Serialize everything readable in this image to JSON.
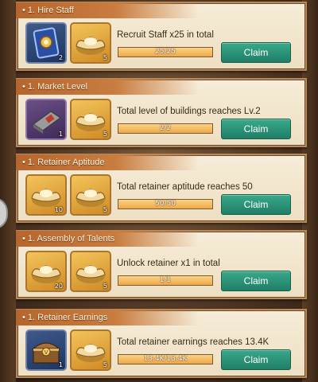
{
  "tasks": [
    {
      "title": "• 1. Hire Staff",
      "description": "Recruit Staff x25 in total",
      "progress_text": "25/25",
      "progress_fraction": 1.0,
      "claim_label": "Claim",
      "rewards": [
        {
          "icon": "recruit-card-icon",
          "qty": "2"
        },
        {
          "icon": "gold-ingot-icon",
          "qty": "5"
        }
      ]
    },
    {
      "title": "• 1. Market Level",
      "description": "Total level of buildings reaches Lv.2",
      "progress_text": "2/2",
      "progress_fraction": 1.0,
      "claim_label": "Claim",
      "rewards": [
        {
          "icon": "book-icon",
          "qty": "1"
        },
        {
          "icon": "gold-ingot-icon",
          "qty": "5"
        }
      ]
    },
    {
      "title": "• 1. Retainer Aptitude",
      "description": "Total retainer aptitude reaches 50",
      "progress_text": "50/50",
      "progress_fraction": 1.0,
      "claim_label": "Claim",
      "rewards": [
        {
          "icon": "gold-ingot-icon",
          "qty": "10"
        },
        {
          "icon": "gold-ingot-icon",
          "qty": "5"
        }
      ]
    },
    {
      "title": "• 1. Assembly of Talents",
      "description": "Unlock  retainer x1 in total",
      "progress_text": "1/1",
      "progress_fraction": 1.0,
      "claim_label": "Claim",
      "rewards": [
        {
          "icon": "gold-ingot-icon",
          "qty": "20"
        },
        {
          "icon": "gold-ingot-icon",
          "qty": "5"
        }
      ]
    },
    {
      "title": "• 1. Retainer Earnings",
      "description": "Total retainer earnings reaches 13.4K",
      "progress_text": "13.4K/13.4K",
      "progress_fraction": 1.0,
      "claim_label": "Claim",
      "rewards": [
        {
          "icon": "treasure-chest-icon",
          "qty": "1"
        },
        {
          "icon": "gold-ingot-icon",
          "qty": "5"
        }
      ]
    }
  ]
}
